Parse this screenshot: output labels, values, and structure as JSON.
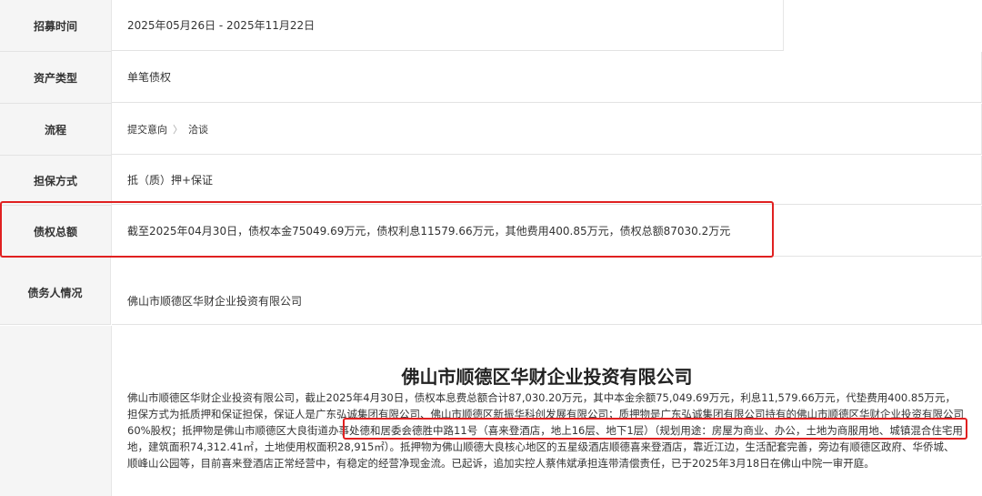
{
  "rows": [
    {
      "label": "招募时间",
      "value": "2025年05月26日 - 2025年11月22日"
    },
    {
      "label": "资产类型",
      "value": "单笔债权"
    },
    {
      "label": "流程",
      "steps": [
        "提交意向",
        "洽谈"
      ]
    },
    {
      "label": "担保方式",
      "value": "抵（质）押+保证"
    },
    {
      "label": "债权总额",
      "value": "截至2025年04月30日，债权本金75049.69万元，债权利息11579.66万元，其他费用400.85万元，债权总额87030.2万元"
    },
    {
      "label": "债务人情况",
      "value": "佛山市顺德区华财企业投资有限公司"
    }
  ],
  "detail": {
    "title": "佛山市顺德区华财企业投资有限公司",
    "para_part1": "佛山市顺德区华财企业投资有限公司，截止2025年4月30日，债权本息费总额合计87,030.20万元，其中本金余额75,049.69万元，利息11,579.66万元，代垫费用400.85万元，担保方式为抵质押和保证担保，保证人是广东弘诚集团有限公司、佛山市顺德区新振华科创发展有限公司；质押物是广东弘诚集团有限公司持有的佛山市顺德区华财企业投资有限公司60%股权；",
    "para_highlight": "抵押物是佛山市顺德区大良街道办事处德和居委会德胜中路11号（喜来登酒店，地上16层、地下1层）（规划用途：房屋",
    "para_part2": "为商业、办公，土地为商服用地、城镇混合住宅用地，建筑面积74,312.41㎡，土地使用权面积28,915㎡）。抵押物为佛山顺德大良核心地区的五星级酒店顺德喜来登酒店，靠近江边，生活配套完善，旁边有顺德区政府、华侨城、顺峰山公园等，目前喜来登酒店正常经营中，有稳定的经营净现金流。已起诉，追加实控人蔡伟斌承担连带清偿责任，已于2025年3月18日在佛山中院一审开庭。"
  },
  "colors": {
    "highlight_border": "#e02020",
    "label_bg": "#f5f5f5"
  }
}
